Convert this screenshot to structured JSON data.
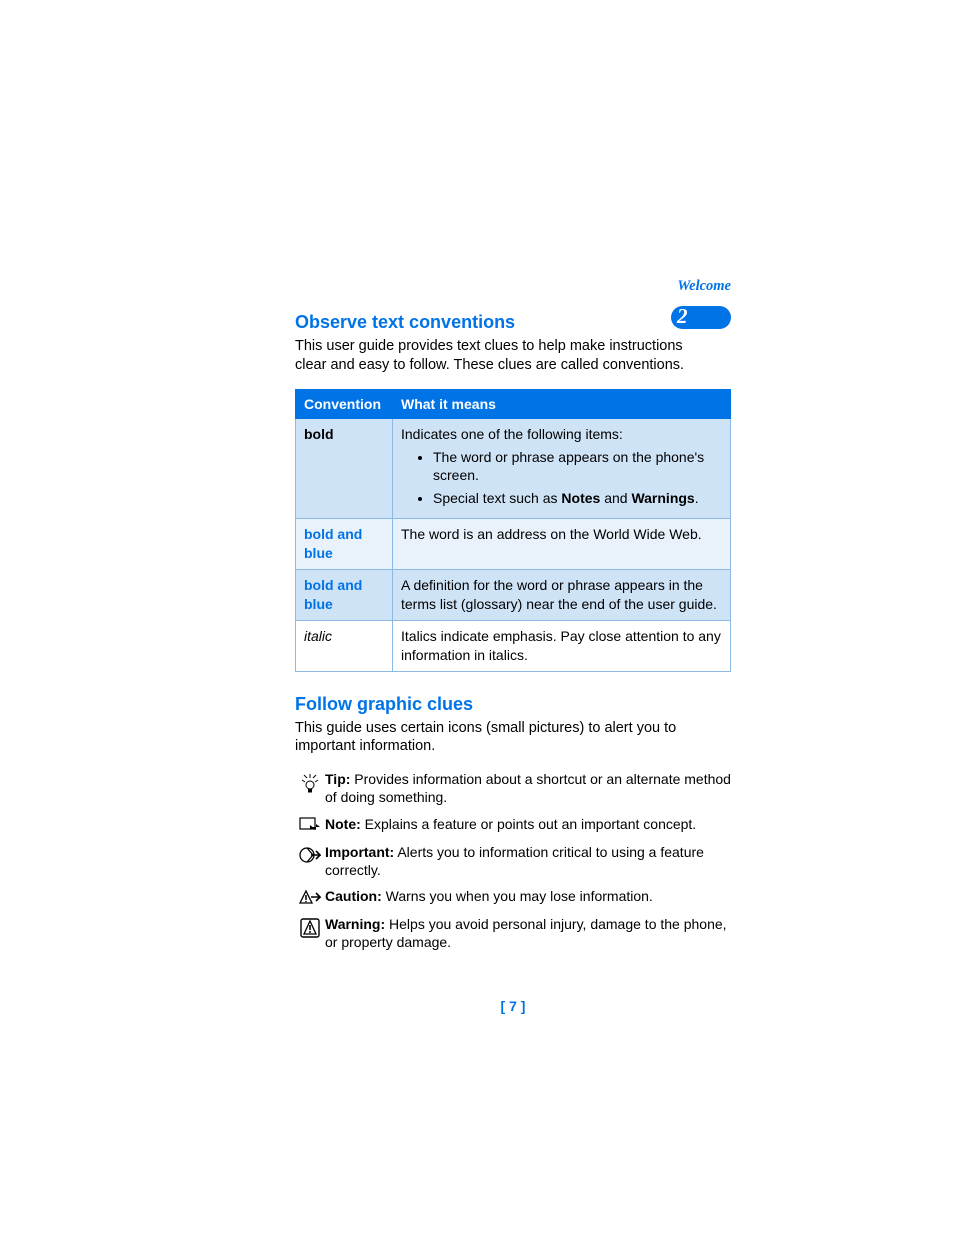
{
  "header": {
    "breadcrumb": "Welcome",
    "chapter_number": "2"
  },
  "section1": {
    "title": "Observe text conventions",
    "intro": "This user guide provides text clues to help make instructions clear and easy to follow. These clues are called conventions."
  },
  "table": {
    "head_convention": "Convention",
    "head_meaning": "What it means",
    "rows": [
      {
        "label": "bold",
        "label_style": "bold",
        "intro": "Indicates one of the following items:",
        "bullets": [
          "The word or phrase appears on the phone's screen.",
          "Special text such as Notes and Warnings."
        ]
      },
      {
        "label": "bold and blue",
        "label_style": "bold-blue",
        "text": "The word is an address on the World Wide Web."
      },
      {
        "label": "bold and blue",
        "label_style": "bold-blue",
        "text": "A definition for the word or phrase appears in the terms list (glossary) near the end of the user guide."
      },
      {
        "label": "italic",
        "label_style": "italic",
        "text": "Italics indicate emphasis. Pay close attention to any information in italics."
      }
    ]
  },
  "section2": {
    "title": "Follow graphic clues",
    "intro": "This guide uses certain icons (small pictures) to alert you to important information."
  },
  "clues": [
    {
      "icon": "tip-icon",
      "lead": "Tip:",
      "text": " Provides information about a shortcut or an alternate method of doing something."
    },
    {
      "icon": "note-icon",
      "lead": "Note:",
      "text": " Explains a feature or points out an important concept."
    },
    {
      "icon": "important-icon",
      "lead": "Important:",
      "text": " Alerts you to information critical to using a feature correctly."
    },
    {
      "icon": "caution-icon",
      "lead": "Caution:",
      "text": " Warns you when you may lose information."
    },
    {
      "icon": "warning-icon",
      "lead": "Warning:",
      "text": " Helps you avoid personal injury, damage to the phone, or property damage."
    }
  ],
  "page_number": "[ 7 ]"
}
